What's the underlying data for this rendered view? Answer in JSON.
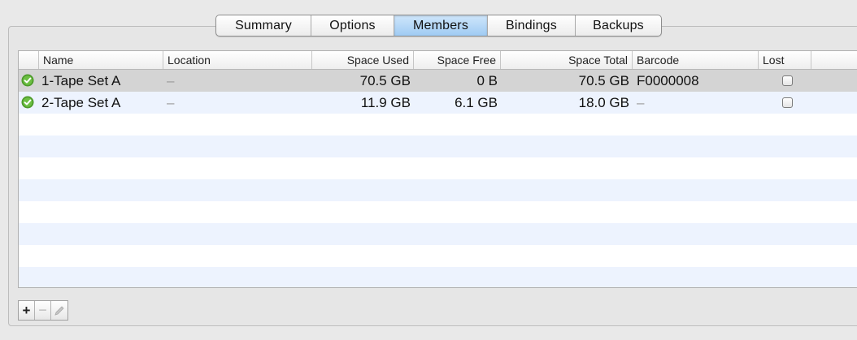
{
  "tabs": {
    "items": [
      {
        "label": "Summary",
        "active": false
      },
      {
        "label": "Options",
        "active": false
      },
      {
        "label": "Members",
        "active": true
      },
      {
        "label": "Bindings",
        "active": false
      },
      {
        "label": "Backups",
        "active": false
      }
    ]
  },
  "table": {
    "columns": {
      "name": "Name",
      "location": "Location",
      "space_used": "Space Used",
      "space_free": "Space Free",
      "space_total": "Space Total",
      "barcode": "Barcode",
      "lost": "Lost"
    },
    "rows": [
      {
        "status_icon": "check-circle-icon",
        "name": "1-Tape Set A",
        "location": "–",
        "space_used": "70.5 GB",
        "space_free": "0 B",
        "space_total": "70.5 GB",
        "barcode": "F0000008",
        "lost": false,
        "selected": true
      },
      {
        "status_icon": "check-circle-icon",
        "name": "2-Tape Set A",
        "location": "–",
        "space_used": "11.9 GB",
        "space_free": "6.1 GB",
        "space_total": "18.0 GB",
        "barcode": "–",
        "lost": false,
        "selected": false
      }
    ]
  },
  "toolbar": {
    "add_label": "+",
    "remove_label": "−",
    "edit_icon": "pencil-icon"
  },
  "colors": {
    "active_tab": "#a9d1f5",
    "row_alt": "#edf3fe",
    "row_selected": "#d4d4d4",
    "status_green": "#4c9a2a"
  }
}
